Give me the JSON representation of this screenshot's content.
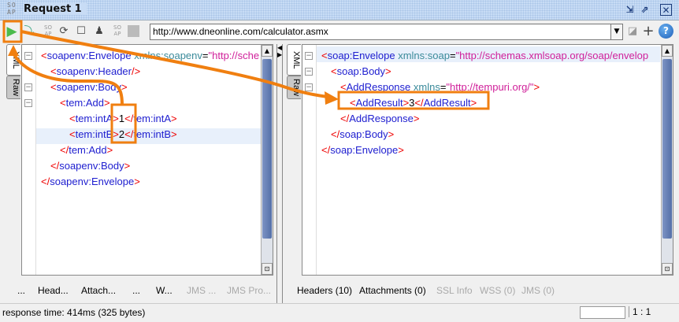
{
  "window": {
    "logo": "SOAP",
    "title": "Request 1"
  },
  "toolbar": {
    "url": "http://www.dneonline.com/calculator.asmx"
  },
  "request": {
    "tabs": [
      "XML",
      "Raw"
    ],
    "lines": [
      [
        [
          "b",
          "<"
        ],
        [
          "n",
          "soapenv:Envelope "
        ],
        [
          "a",
          "xmlns:soapenv"
        ],
        [
          "t",
          "="
        ],
        [
          "v",
          "\"http://sche"
        ]
      ],
      [
        [
          "b",
          "<"
        ],
        [
          "n",
          "soapenv:Header"
        ],
        [
          "b",
          "/>"
        ]
      ],
      [
        [
          "b",
          "<"
        ],
        [
          "n",
          "soapenv:Body"
        ],
        [
          "b",
          ">"
        ]
      ],
      [
        [
          "b",
          "<"
        ],
        [
          "n",
          "tem:Add"
        ],
        [
          "b",
          ">"
        ]
      ],
      [
        [
          "b",
          "<"
        ],
        [
          "n",
          "tem:intA"
        ],
        [
          "b",
          ">"
        ],
        [
          "t",
          "1"
        ],
        [
          "b",
          "</"
        ],
        [
          "n",
          "tem:intA"
        ],
        [
          "b",
          ">"
        ]
      ],
      [
        [
          "b",
          "<"
        ],
        [
          "n",
          "tem:intB"
        ],
        [
          "b",
          ">"
        ],
        [
          "t",
          "2"
        ],
        [
          "b",
          "</"
        ],
        [
          "n",
          "tem:intB"
        ],
        [
          "b",
          ">"
        ]
      ],
      [
        [
          "b",
          "</"
        ],
        [
          "n",
          "tem:Add"
        ],
        [
          "b",
          ">"
        ]
      ],
      [
        [
          "b",
          "</"
        ],
        [
          "n",
          "soapenv:Body"
        ],
        [
          "b",
          ">"
        ]
      ],
      [
        [
          "b",
          "</"
        ],
        [
          "n",
          "soapenv:Envelope"
        ],
        [
          "b",
          ">"
        ]
      ]
    ],
    "bottom_tabs": [
      "...",
      "Head...",
      "Attach...",
      "...",
      "W...",
      "JMS ...",
      "JMS Pro..."
    ]
  },
  "response": {
    "tabs": [
      "XML",
      "Raw"
    ],
    "lines": [
      [
        [
          "b",
          "<"
        ],
        [
          "n",
          "soap:Envelope "
        ],
        [
          "a",
          "xmlns:soap"
        ],
        [
          "t",
          "="
        ],
        [
          "v",
          "\"http://schemas.xmlsoap.org/soap/envelop"
        ]
      ],
      [
        [
          "b",
          "<"
        ],
        [
          "n",
          "soap:Body"
        ],
        [
          "b",
          ">"
        ]
      ],
      [
        [
          "b",
          "<"
        ],
        [
          "n",
          "AddResponse "
        ],
        [
          "a",
          "xmlns"
        ],
        [
          "t",
          "="
        ],
        [
          "v",
          "\"http://tempuri.org/\""
        ],
        [
          "b",
          ">"
        ]
      ],
      [
        [
          "b",
          "<"
        ],
        [
          "n",
          "AddResult"
        ],
        [
          "b",
          ">"
        ],
        [
          "t",
          "3"
        ],
        [
          "b",
          "</"
        ],
        [
          "n",
          "AddResult"
        ],
        [
          "b",
          ">"
        ]
      ],
      [
        [
          "b",
          "</"
        ],
        [
          "n",
          "AddResponse"
        ],
        [
          "b",
          ">"
        ]
      ],
      [
        [
          "b",
          "</"
        ],
        [
          "n",
          "soap:Body"
        ],
        [
          "b",
          ">"
        ]
      ],
      [
        [
          "b",
          "</"
        ],
        [
          "n",
          "soap:Envelope"
        ],
        [
          "b",
          ">"
        ]
      ]
    ],
    "bottom_tabs": [
      "Headers (10)",
      "Attachments (0)",
      "SSL Info",
      "WSS (0)",
      "JMS (0)"
    ]
  },
  "status": {
    "text": "response time: 414ms (325 bytes)",
    "position": "1 : 1"
  },
  "colors": {
    "annotation": "#f07f10",
    "tag_bracket": "#e00000",
    "tag_name": "#2020d0"
  }
}
